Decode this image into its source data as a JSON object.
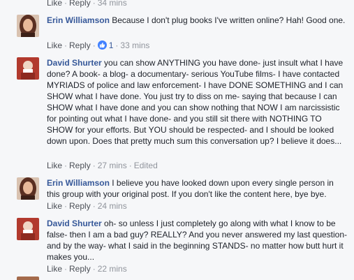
{
  "top_actions": {
    "like": "Like",
    "reply": "Reply",
    "time": "34 mins"
  },
  "comments": [
    {
      "author": "Erin Williamson",
      "text": "Because I don't plug books I've written online? Hah! Good one.",
      "like": "Like",
      "reply": "Reply",
      "likes": "1",
      "time": "33 mins",
      "avatar_color": "#6b3a2a"
    },
    {
      "author": "David Shurter",
      "text": "you can show ANYTHING you have done- just insult what I have done? A book- a blog- a documentary- serious YouTube films- I have contacted MYRIADS of police and law enforcement- I have DONE SOMETHING and I can SHOW what I have done. You just try to diss on me- saying that because I can SHOW what I have done and you can show nothing that NOW I am narcissistic for pointing out what I have done- and you still sit there with NOTHING TO SHOW for your efforts. But YOU should be respected- and I should be looked down upon. Does that pretty much sum this conversation up? I believe it does...",
      "like": "Like",
      "reply": "Reply",
      "time": "27 mins",
      "edited": "Edited",
      "avatar_color": "#c0392b"
    },
    {
      "author": "Erin Williamson",
      "text": "I believe you have looked down upon every single person in this group with your original post. If you don't like the content here, bye bye.",
      "like": "Like",
      "reply": "Reply",
      "time": "24 mins",
      "avatar_color": "#6b3a2a"
    },
    {
      "author": "David Shurter",
      "text": "oh- so unless I just completely go along with what I know to be false- then I am a bad guy? REALLY? And you never answered my last question- and by the way- what I said in the beginning STANDS- no matter how butt hurt it makes you...",
      "like": "Like",
      "reply": "Reply",
      "time": "22 mins",
      "avatar_color": "#c0392b"
    }
  ],
  "colors": {
    "author": "#365899",
    "meta": "#90949c",
    "background": "#f6f7f9",
    "like_badge": "#4080ff"
  },
  "icons": {
    "like_badge": "thumbs-up-icon"
  }
}
